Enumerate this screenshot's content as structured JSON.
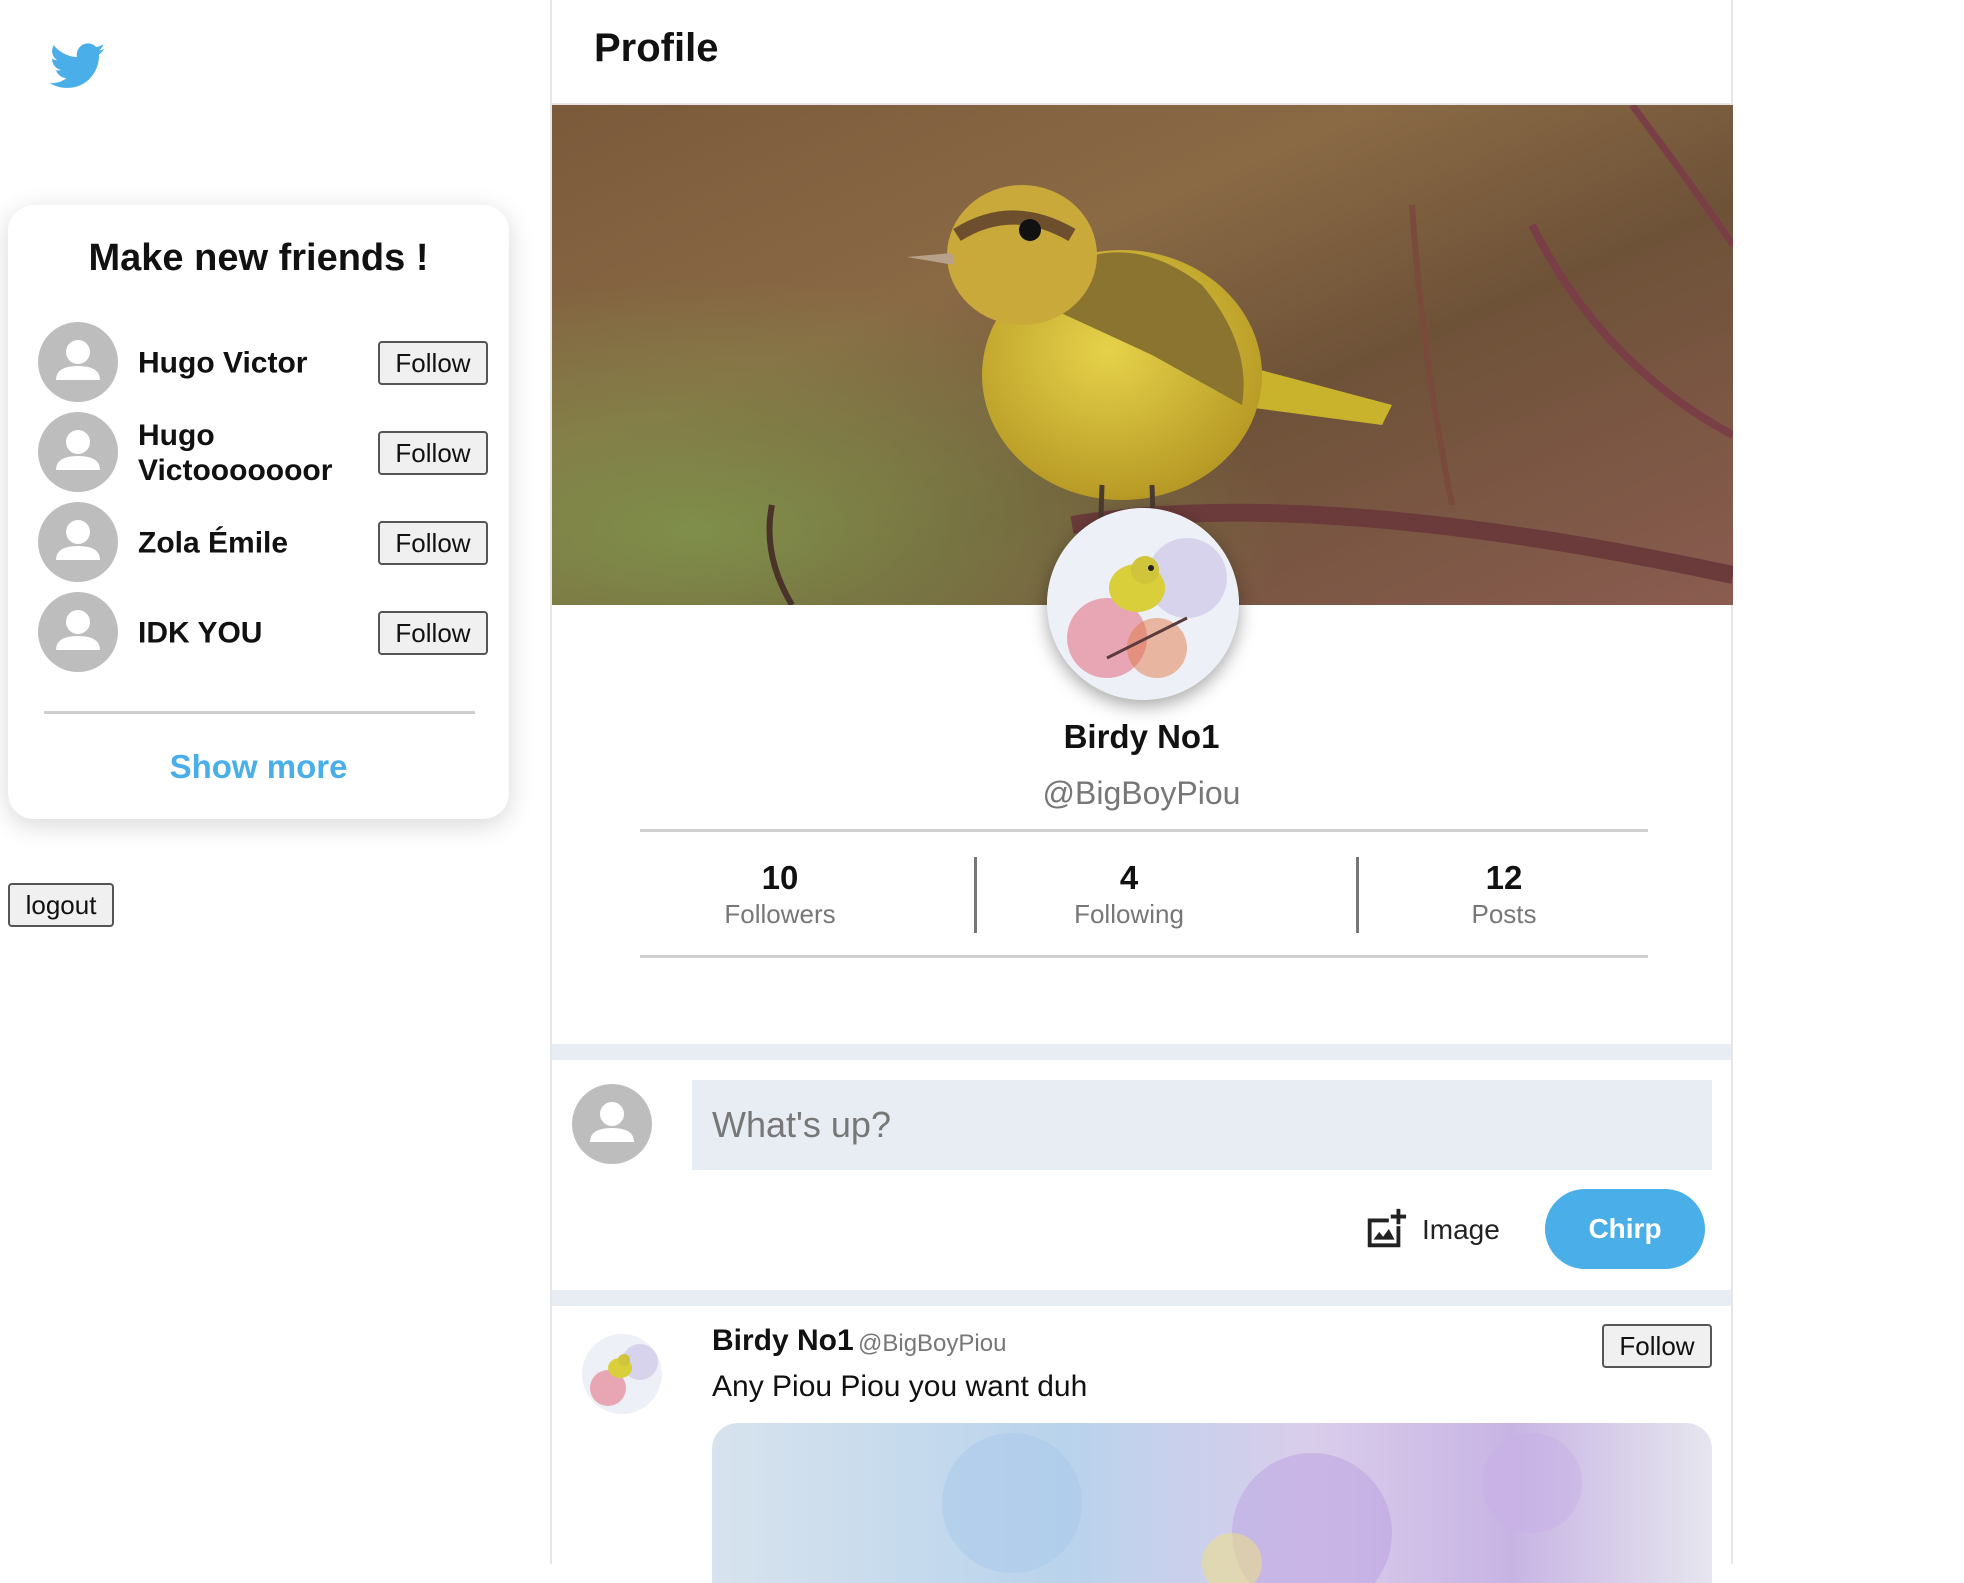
{
  "app": {
    "brand": "twitter",
    "accent_color": "#4aaee8",
    "logo_icon": "twitter-bird-icon"
  },
  "sidebar": {
    "friends_card": {
      "title": "Make new friends !",
      "follow_label": "Follow",
      "suggestions": [
        {
          "name": "Hugo Victor",
          "avatar_icon": "default-user-icon"
        },
        {
          "name": "Hugo Victooooooor",
          "avatar_icon": "default-user-icon"
        },
        {
          "name": "Zola Émile",
          "avatar_icon": "default-user-icon"
        },
        {
          "name": "IDK YOU",
          "avatar_icon": "default-user-icon"
        }
      ],
      "show_more_label": "Show more"
    },
    "logout_label": "logout"
  },
  "main": {
    "page_title": "Profile",
    "profile": {
      "name": "Birdy No1",
      "handle": "@BigBoyPiou",
      "stats": [
        {
          "value": "10",
          "label": "Followers"
        },
        {
          "value": "4",
          "label": "Following"
        },
        {
          "value": "12",
          "label": "Posts"
        }
      ]
    },
    "composer": {
      "placeholder": "What's up?",
      "image_label": "Image",
      "image_icon": "add-image-icon",
      "submit_label": "Chirp"
    },
    "feed": [
      {
        "author_name": "Birdy No1",
        "author_handle": "@BigBoyPiou",
        "follow_label": "Follow",
        "text": "Any Piou Piou you want duh"
      }
    ]
  }
}
